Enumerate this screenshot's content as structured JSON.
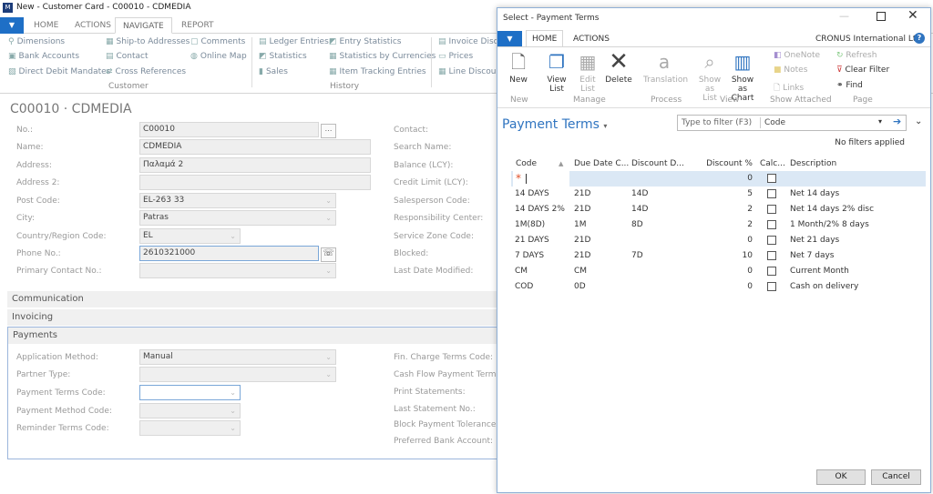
{
  "window": {
    "title": "New - Customer Card - C00010 - CDMEDIA"
  },
  "tabs": [
    "HOME",
    "ACTIONS",
    "NAVIGATE",
    "REPORT"
  ],
  "active_tab": "NAVIGATE",
  "ribbon": {
    "customer_items": [
      "Dimensions",
      "Ship-to Addresses",
      "Comments",
      "Bank Accounts",
      "Contact",
      "Online Map",
      "Direct Debit Mandates",
      "Cross References"
    ],
    "customer_label": "Customer",
    "history_items": [
      "Ledger Entries",
      "Entry Statistics",
      "Statistics",
      "Statistics by Currencies",
      "Sales",
      "Item Tracking Entries"
    ],
    "history_label": "History",
    "prices_items": [
      "Invoice Disco",
      "Prices",
      "Line Discoun"
    ]
  },
  "card": {
    "title": "C00010 · CDMEDIA",
    "general": [
      {
        "label": "No.:",
        "value": "C00010"
      },
      {
        "label": "Name:",
        "value": "CDMEDIA"
      },
      {
        "label": "Address:",
        "value": "Παλαμά 2"
      },
      {
        "label": "Address 2:",
        "value": ""
      },
      {
        "label": "Post Code:",
        "value": "EL-263 33"
      },
      {
        "label": "City:",
        "value": "Patras"
      },
      {
        "label": "Country/Region Code:",
        "value": "EL"
      },
      {
        "label": "Phone No.:",
        "value": "2610321000"
      },
      {
        "label": "Primary Contact No.:",
        "value": ""
      }
    ],
    "general_right": [
      "Contact:",
      "Search Name:",
      "Balance (LCY):",
      "Credit Limit (LCY):",
      "Salesperson Code:",
      "Responsibility Center:",
      "Service Zone Code:",
      "Blocked:",
      "Last Date Modified:"
    ],
    "sections": [
      "Communication",
      "Invoicing",
      "Payments"
    ],
    "payments": [
      {
        "label": "Application Method:",
        "value": "Manual"
      },
      {
        "label": "Partner Type:",
        "value": ""
      },
      {
        "label": "Payment Terms Code:",
        "value": ""
      },
      {
        "label": "Payment Method Code:",
        "value": ""
      },
      {
        "label": "Reminder Terms Code:",
        "value": ""
      }
    ],
    "payments_right": [
      "Fin. Charge Terms Code:",
      "Cash Flow Payment Terms C",
      "Print Statements:",
      "Last Statement No.:",
      "Block Payment Tolerance:",
      "Preferred Bank Account:"
    ]
  },
  "dialog": {
    "title": "Select - Payment Terms",
    "tabs": [
      "HOME",
      "ACTIONS"
    ],
    "company": "CRONUS International Ltd.",
    "buttons": {
      "new": "New",
      "view_list": "View List",
      "edit_list": "Edit List",
      "delete": "Delete",
      "translation": "Translation",
      "show_as_list": "Show as List",
      "show_as_chart": "Show as Chart",
      "onenote": "OneNote",
      "notes": "Notes",
      "links": "Links",
      "refresh": "Refresh",
      "clear_filter": "Clear Filter",
      "find": "Find"
    },
    "groups": [
      "New",
      "Manage",
      "Process",
      "View",
      "Show Attached",
      "Page"
    ],
    "list_title": "Payment Terms",
    "filter_placeholder": "Type to filter (F3)",
    "filter_field": "Code",
    "filter_status": "No filters applied",
    "columns": [
      "Code",
      "Due Date C...",
      "Discount D...",
      "Discount %",
      "Calc...",
      "Description"
    ],
    "new_row": {
      "discount": "0"
    },
    "rows": [
      {
        "code": "14 DAYS",
        "due": "21D",
        "disc_date": "14D",
        "disc": "5",
        "desc": "Net 14 days"
      },
      {
        "code": "14 DAYS 2%",
        "due": "21D",
        "disc_date": "14D",
        "disc": "2",
        "desc": "Net 14 days 2% disc"
      },
      {
        "code": "1M(8D)",
        "due": "1M",
        "disc_date": "8D",
        "disc": "2",
        "desc": "1 Month/2% 8 days"
      },
      {
        "code": "21 DAYS",
        "due": "21D",
        "disc_date": "",
        "disc": "0",
        "desc": "Net 21 days"
      },
      {
        "code": "7 DAYS",
        "due": "21D",
        "disc_date": "7D",
        "disc": "10",
        "desc": "Net 7 days"
      },
      {
        "code": "CM",
        "due": "CM",
        "disc_date": "",
        "disc": "0",
        "desc": "Current Month"
      },
      {
        "code": "COD",
        "due": "0D",
        "disc_date": "",
        "disc": "0",
        "desc": "Cash on delivery"
      }
    ],
    "ok": "OK",
    "cancel": "Cancel"
  },
  "colors": {
    "accent": "#1e6fc6",
    "selected_row": "#dbe8f5",
    "title_blue": "#2f74c0"
  }
}
